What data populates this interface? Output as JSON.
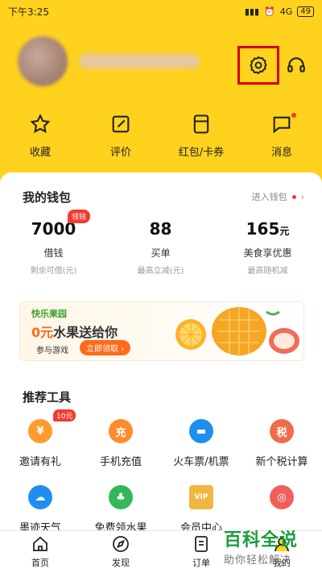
{
  "status_bar": {
    "time": "下午3:25",
    "signal": "4G",
    "battery": "49"
  },
  "quick_actions": [
    {
      "label": "收藏",
      "icon": "star-icon"
    },
    {
      "label": "评价",
      "icon": "edit-icon"
    },
    {
      "label": "红包/卡券",
      "icon": "coupon-icon"
    },
    {
      "label": "消息",
      "icon": "message-icon"
    }
  ],
  "wallet": {
    "title": "我的钱包",
    "link": "进入钱包",
    "stats": [
      {
        "value": "7000",
        "unit": "",
        "name": "借钱",
        "sub": "剩余可借(元)",
        "badge": "领钱"
      },
      {
        "value": "88",
        "unit": "",
        "name": "买单",
        "sub": "最高立减(元)",
        "badge": ""
      },
      {
        "value": "165",
        "unit": "元",
        "name": "美食享优惠",
        "sub": "最高随机减",
        "badge": ""
      }
    ]
  },
  "banner": {
    "game": "快乐果园",
    "zero": "0元",
    "headline": "水果送给你",
    "sub": "参与游戏",
    "claim": "立即领取 ›"
  },
  "tools": {
    "title": "推荐工具",
    "items": [
      {
        "label": "邀请有礼",
        "icon": "gift-icon",
        "color": "#ff9b2f",
        "glyph": "¥",
        "badge": "10元"
      },
      {
        "label": "手机充值",
        "icon": "recharge-icon",
        "color": "#ff8c2a",
        "glyph": "充",
        "badge": ""
      },
      {
        "label": "火车票/机票",
        "icon": "train-icon",
        "color": "#1e8ff0",
        "glyph": "▬",
        "badge": ""
      },
      {
        "label": "新个税计算",
        "icon": "tax-icon",
        "color": "#f26b4a",
        "glyph": "税",
        "badge": ""
      },
      {
        "label": "墨迹天气",
        "icon": "weather-icon",
        "color": "#1e8ff0",
        "glyph": "☁",
        "badge": ""
      },
      {
        "label": "免费领水果",
        "icon": "tree-icon",
        "color": "#34b65a",
        "glyph": "♣",
        "badge": ""
      },
      {
        "label": "会员中心",
        "icon": "vip-icon",
        "color": "#f0b640",
        "glyph": "VIP",
        "badge": ""
      },
      {
        "label": "",
        "icon": "coupon-circle-icon",
        "color": "#f0605a",
        "glyph": "◎",
        "badge": ""
      }
    ]
  },
  "tabbar": [
    {
      "label": "首页",
      "icon": "home-icon"
    },
    {
      "label": "发现",
      "icon": "compass-icon"
    },
    {
      "label": "订单",
      "icon": "order-icon"
    },
    {
      "label": "我的",
      "icon": "profile-icon"
    }
  ],
  "watermark": {
    "title": "百科全说",
    "subtitle": "助你轻松解决"
  },
  "colors": {
    "brand_yellow": "#ffd21e",
    "accent_red": "#f23b2d",
    "highlight_box": "#d40000"
  }
}
